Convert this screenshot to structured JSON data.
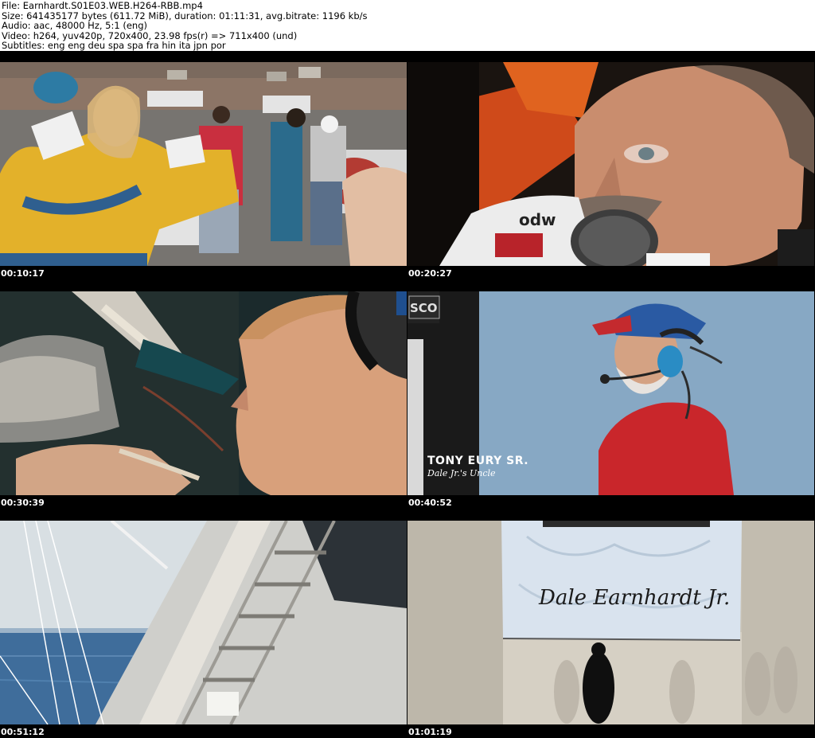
{
  "header": {
    "file": "File: Earnhardt.S01E03.WEB.H264-RBB.mp4",
    "size": "Size: 641435177 bytes (611.72 MiB), duration: 01:11:31, avg.bitrate: 1196 kb/s",
    "audio": "Audio: aac, 48000 Hz, 5:1 (eng)",
    "video": "Video: h264, yuv420p, 720x400, 23.98 fps(r) => 711x400 (und)",
    "subtitles": "Subtitles: eng eng deu spa spa fra hin ita jpn por"
  },
  "thumbnails": [
    {
      "timestamp": "00:10:17",
      "scene": "woman in yellow jacket at race pits"
    },
    {
      "timestamp": "00:20:27",
      "scene": "driver speaking into microphone"
    },
    {
      "timestamp": "00:30:39",
      "scene": "crew member with headset profile"
    },
    {
      "timestamp": "00:40:52",
      "scene": "man in red shirt with headset",
      "lower_third": {
        "name": "TONY EURY SR.",
        "subtitle": "Dale Jr.'s Uncle"
      },
      "sign_text": "SCO"
    },
    {
      "timestamp": "00:51:12",
      "scene": "boat ladder over ocean"
    },
    {
      "timestamp": "01:01:19",
      "scene": "signed banner and silhouette",
      "banner_text": "Dale Earnhardt Jr."
    }
  ],
  "colors": {
    "background": "#000000",
    "header_background": "#ffffff",
    "timestamp_text": "#ffffff"
  }
}
